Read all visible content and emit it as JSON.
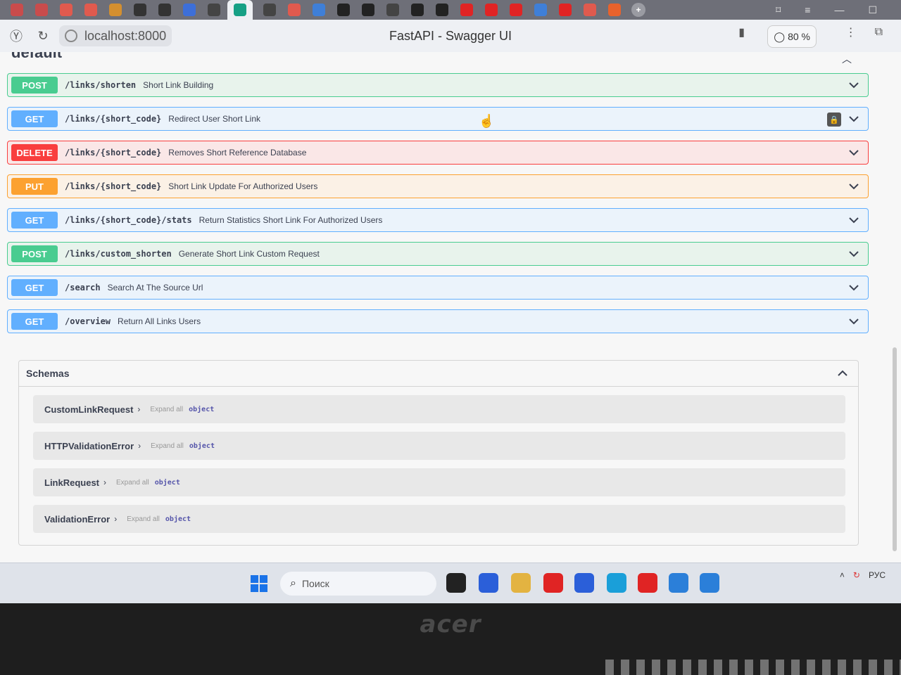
{
  "browser": {
    "url": "localhost:8000",
    "title": "FastAPI - Swagger UI",
    "zoom": "80 %"
  },
  "tabs": [
    {
      "icon": "mail-icon",
      "color": "#c94c4c"
    },
    {
      "icon": "mail-icon",
      "color": "#c94c4c"
    },
    {
      "icon": "yandex-icon",
      "color": "#e05a4e"
    },
    {
      "icon": "yandex-icon",
      "color": "#e05a4e"
    },
    {
      "icon": "image-icon",
      "color": "#d48f2f"
    },
    {
      "icon": "code-icon",
      "color": "#333"
    },
    {
      "icon": "dot-icon",
      "color": "#333"
    },
    {
      "icon": "s-icon",
      "color": "#3d6fd8"
    },
    {
      "icon": "gear-icon",
      "color": "#444"
    },
    {
      "icon": "fastapi-icon",
      "color": "#16a085"
    },
    {
      "icon": "bug-icon",
      "color": "#444"
    },
    {
      "icon": "yandex-icon",
      "color": "#e05a4e"
    },
    {
      "icon": "check-icon",
      "color": "#3f7fd8"
    },
    {
      "icon": "github-icon",
      "color": "#222"
    },
    {
      "icon": "github-icon",
      "color": "#222"
    },
    {
      "icon": "bug-icon",
      "color": "#444"
    },
    {
      "icon": "x-icon",
      "color": "#222"
    },
    {
      "icon": "github-icon",
      "color": "#222"
    },
    {
      "icon": "youtube-icon",
      "color": "#e02424"
    },
    {
      "icon": "youtube-icon",
      "color": "#e02424"
    },
    {
      "icon": "youtube-icon",
      "color": "#e02424"
    },
    {
      "icon": "puzzle-icon",
      "color": "#3f7fd8"
    },
    {
      "icon": "play-icon",
      "color": "#e02424"
    },
    {
      "icon": "yandex-icon",
      "color": "#e05a4e"
    },
    {
      "icon": "rocket-icon",
      "color": "#e8622c"
    }
  ],
  "swagger": {
    "section_title": "default",
    "operations": [
      {
        "method": "POST",
        "path": "/links/shorten",
        "summary": "Short Link Building",
        "type": "post"
      },
      {
        "method": "GET",
        "path": "/links/{short_code}",
        "summary": "Redirect User Short Link",
        "type": "get",
        "locked": true
      },
      {
        "method": "DELETE",
        "path": "/links/{short_code}",
        "summary": "Removes Short Reference Database",
        "type": "delete"
      },
      {
        "method": "PUT",
        "path": "/links/{short_code}",
        "summary": "Short Link Update For Authorized Users",
        "type": "put"
      },
      {
        "method": "GET",
        "path": "/links/{short_code}/stats",
        "summary": "Return Statistics Short Link For Authorized Users",
        "type": "get"
      },
      {
        "method": "POST",
        "path": "/links/custom_shorten",
        "summary": "Generate Short Link Custom Request",
        "type": "post"
      },
      {
        "method": "GET",
        "path": "/search",
        "summary": "Search At The Source Url",
        "type": "get"
      },
      {
        "method": "GET",
        "path": "/overview",
        "summary": "Return All Links Users",
        "type": "get"
      }
    ],
    "schemas": {
      "title": "Schemas",
      "models": [
        {
          "name": "CustomLinkRequest",
          "expand": "Expand all",
          "type": "object"
        },
        {
          "name": "HTTPValidationError",
          "expand": "Expand all",
          "type": "object"
        },
        {
          "name": "LinkRequest",
          "expand": "Expand all",
          "type": "object"
        },
        {
          "name": "ValidationError",
          "expand": "Expand all",
          "type": "object"
        }
      ]
    }
  },
  "taskbar": {
    "search_placeholder": "Поиск",
    "language": "РУС",
    "apps": [
      {
        "icon": "task-view-icon",
        "color": "#222"
      },
      {
        "icon": "meet-icon",
        "color": "#2b5fd9"
      },
      {
        "icon": "folder-icon",
        "color": "#e3b341"
      },
      {
        "icon": "yandex-browser-icon",
        "color": "#e02424"
      },
      {
        "icon": "store-icon",
        "color": "#2b5fd9"
      },
      {
        "icon": "edge-icon",
        "color": "#1a9fd9"
      },
      {
        "icon": "yandex-icon",
        "color": "#e02424"
      },
      {
        "icon": "vscode-icon",
        "color": "#2b7fd9"
      },
      {
        "icon": "app-icon",
        "color": "#2b7fd9"
      }
    ]
  },
  "device": {
    "brand": "acer"
  }
}
